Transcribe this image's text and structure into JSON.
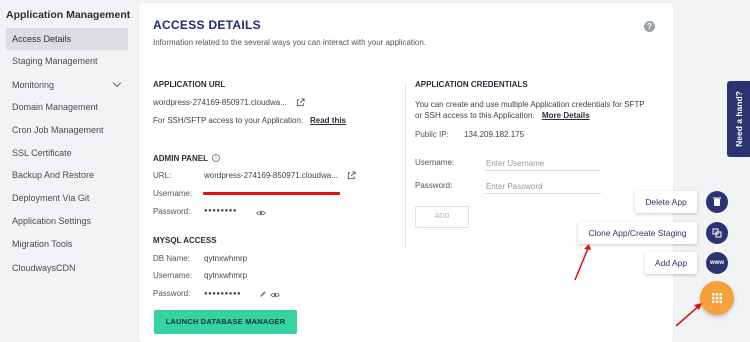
{
  "sidebar": {
    "heading": "Application Management",
    "items": [
      {
        "label": "Access Details",
        "active": true
      },
      {
        "label": "Staging Management"
      },
      {
        "label": "Monitoring",
        "has_chevron": true
      },
      {
        "label": "Domain Management"
      },
      {
        "label": "Cron Job Management"
      },
      {
        "label": "SSL Certificate"
      },
      {
        "label": "Backup And Restore"
      },
      {
        "label": "Deployment Via Git"
      },
      {
        "label": "Application Settings"
      },
      {
        "label": "Migration Tools"
      },
      {
        "label": "CloudwaysCDN"
      }
    ]
  },
  "main": {
    "title": "ACCESS DETAILS",
    "subtitle": "Information related to the several ways you can interact with your application.",
    "app_url": {
      "heading": "APPLICATION URL",
      "url": "wordpress-274169-850971.cloudwa...",
      "ssh_text": "For SSH/SFTP access to your Application.",
      "ssh_link": "Read this"
    },
    "admin_panel": {
      "heading": "ADMIN PANEL",
      "url_label": "URL:",
      "url_value": "wordpress-274169-850971.cloudwa...",
      "username_label": "Username:",
      "password_label": "Password:",
      "password_mask": "●●●●●●●●"
    },
    "mysql": {
      "heading": "MYSQL ACCESS",
      "db_label": "DB Name:",
      "db_value": "qytnxwhmrp",
      "username_label": "Username:",
      "username_value": "qytnxwhmrp",
      "password_label": "Password:",
      "password_mask": "●●●●●●●●●",
      "launch_button": "LAUNCH DATABASE MANAGER"
    },
    "credentials": {
      "heading": "APPLICATION CREDENTIALS",
      "desc_line1": "You can create and use multiple Application credentials for SFTP",
      "desc_line2": "or SSH access to this Application.",
      "more_link": "More Details",
      "public_ip_label": "Public IP:",
      "public_ip_value": "134.209.182.175",
      "username_label": "Username:",
      "username_placeholder": "Enter Username",
      "password_label": "Password:",
      "password_placeholder": "Enter Password",
      "add_button": "ADD"
    }
  },
  "floating": {
    "delete_label": "Delete App",
    "clone_label": "Clone App/Create Staging",
    "add_label": "Add App",
    "www_text": "www"
  },
  "need_hand": "Need a hand?",
  "colors": {
    "brand_navy": "#2c3370",
    "title_blue": "#1e2a78",
    "launch_green": "#35d3a0",
    "fab_orange": "#f5a03a",
    "annotation_red": "#e01010"
  }
}
